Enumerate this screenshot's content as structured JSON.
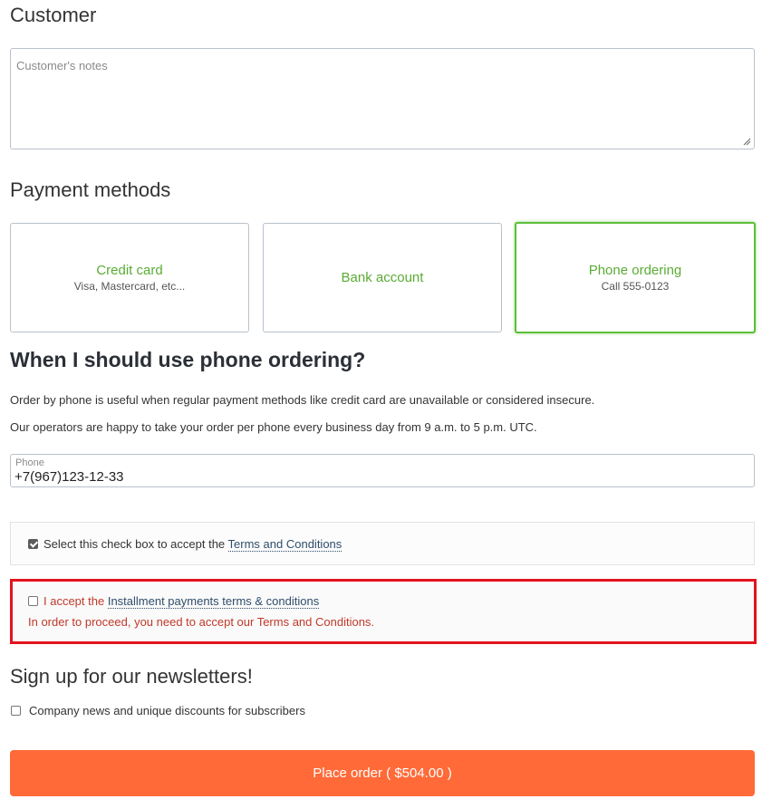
{
  "customer": {
    "title": "Customer",
    "notes_placeholder": "Customer's notes"
  },
  "payment": {
    "title": "Payment methods",
    "methods": [
      {
        "name": "Credit card",
        "sub": "Visa, Mastercard, etc..."
      },
      {
        "name": "Bank account",
        "sub": ""
      },
      {
        "name": "Phone ordering",
        "sub": "Call 555-0123"
      }
    ],
    "selected": "Phone ordering"
  },
  "phone_info": {
    "heading": "When I should use phone ordering?",
    "p1": "Order by phone is useful when regular payment methods like credit card are unavailable or considered insecure.",
    "p2": "Our operators are happy to take your order per phone every business day from 9 a.m. to 5 p.m. UTC.",
    "field_label": "Phone",
    "field_value": "+7(967)123-12-33"
  },
  "terms": {
    "text": "Select this check box to accept the ",
    "link": "Terms and Conditions",
    "checked": true
  },
  "installment": {
    "text": "I accept the ",
    "link": "Installment payments terms & conditions",
    "error": "In order to proceed, you need to accept our Terms and Conditions.",
    "checked": false
  },
  "newsletter": {
    "title": "Sign up for our newsletters!",
    "option": "Company news and unique discounts for subscribers",
    "checked": false
  },
  "order": {
    "button_label": "Place order ( $504.00 )"
  },
  "colors": {
    "accent_green": "#5aac35",
    "error_red": "#e3141e",
    "order_orange": "#ff6a38"
  }
}
